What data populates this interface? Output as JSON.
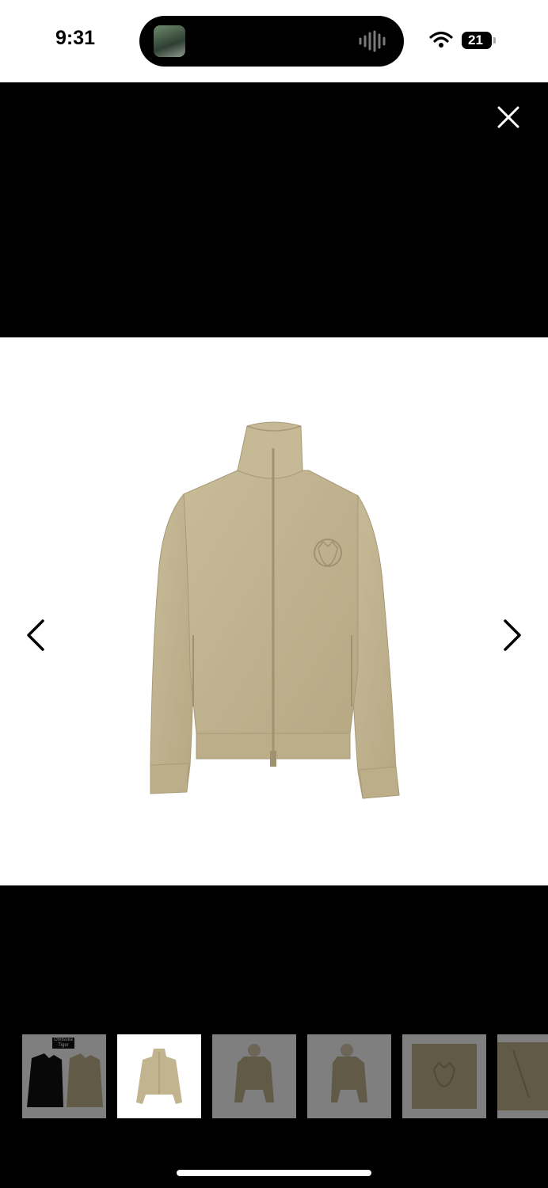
{
  "status_bar": {
    "time": "9:31",
    "battery": "21",
    "island_thumbnail_icon": "now-playing-artwork",
    "island_wave_icon": "audio-waveform-icon"
  },
  "viewer": {
    "close_icon": "close-icon",
    "prev_icon": "chevron-left-icon",
    "next_icon": "chevron-right-icon",
    "product_image": "beige-suede-track-jacket",
    "selected_index": 1
  },
  "thumbnails": [
    {
      "name": "black-and-beige-jackets",
      "brand_label": "Onitsuka Tiger"
    },
    {
      "name": "beige-jacket-front"
    },
    {
      "name": "beige-jacket-model-front"
    },
    {
      "name": "beige-jacket-model-side"
    },
    {
      "name": "tiger-emblem-detail"
    },
    {
      "name": "fabric-detail"
    }
  ],
  "colors": {
    "jacket": "#c2b48f",
    "background": "#000000",
    "image_bg": "#ffffff"
  }
}
